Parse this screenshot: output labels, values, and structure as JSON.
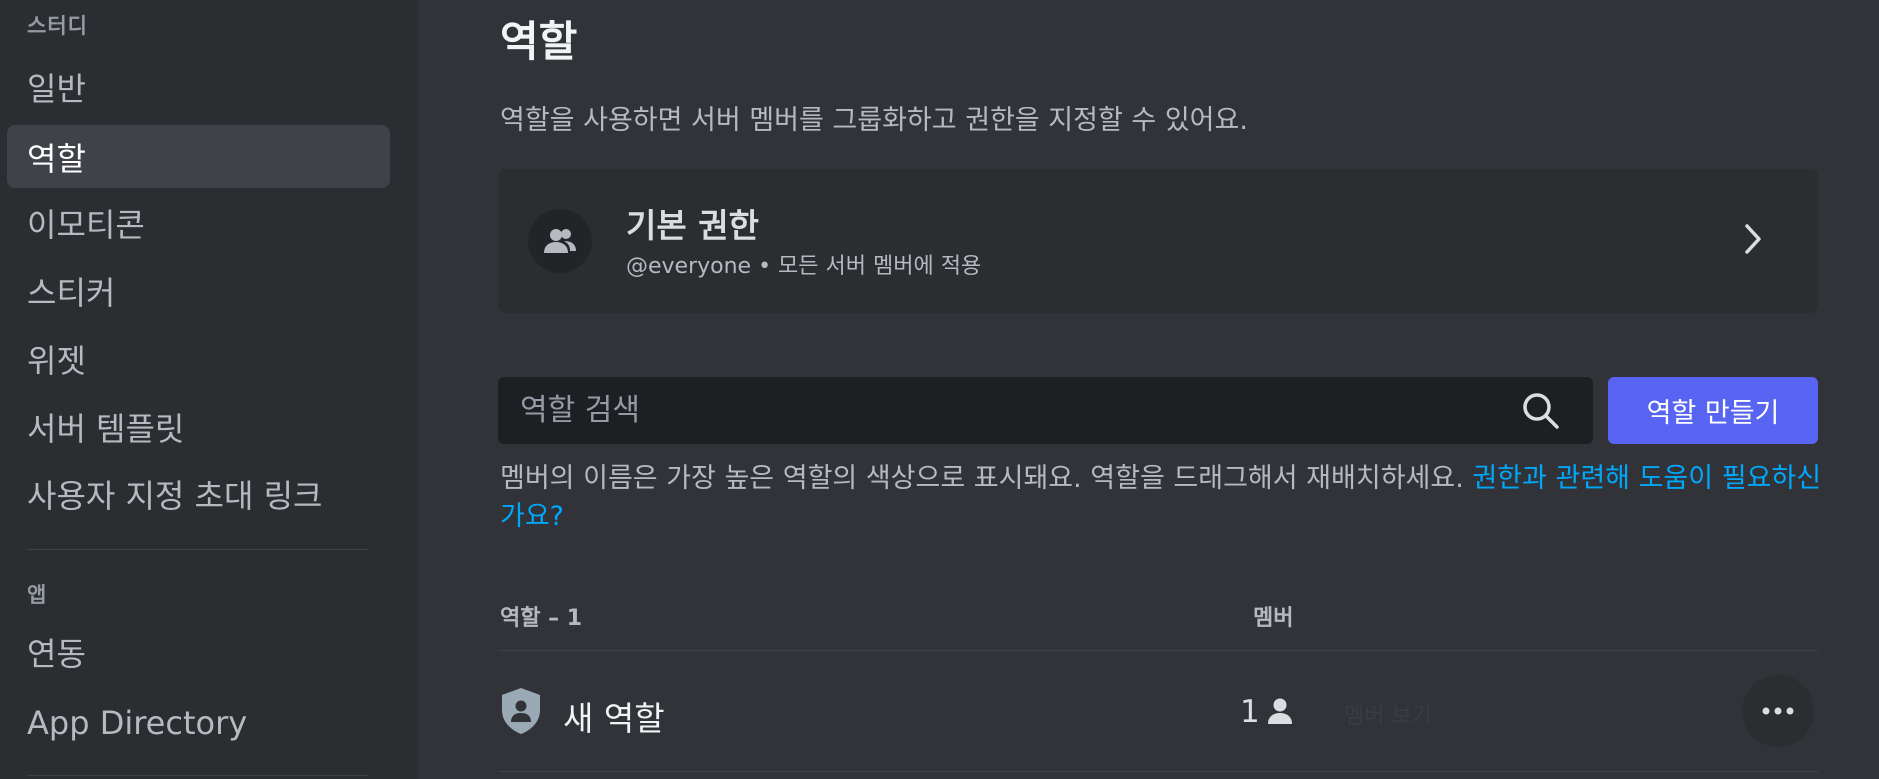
{
  "sidebar": {
    "section_server": "스터디",
    "items": [
      {
        "label": "일반"
      },
      {
        "label": "역할"
      },
      {
        "label": "이모티콘"
      },
      {
        "label": "스티커"
      },
      {
        "label": "위젯"
      },
      {
        "label": "서버 템플릿"
      },
      {
        "label": "사용자 지정 초대 링크"
      }
    ],
    "section_apps": "앱",
    "app_items": [
      {
        "label": "연동"
      },
      {
        "label": "App Directory"
      }
    ],
    "selected": "역할"
  },
  "main": {
    "title": "역할",
    "description": "역할을 사용하면 서버 멤버를 그룹화하고 권한을 지정할 수 있어요.",
    "default_permissions": {
      "title": "기본 권한",
      "subtitle": "@everyone • 모든 서버 멤버에 적용"
    },
    "search": {
      "placeholder": "역할 검색"
    },
    "create_button": "역할 만들기",
    "help_text": "멤버의 이름은 가장 높은 역할의 색상으로 표시돼요. 역할을 드래그해서 재배치하세요. ",
    "help_link": "권한과 관련해 도움이 필요하신가요?",
    "table": {
      "col_roles": "역할 – 1",
      "col_members": "멤버",
      "rows": [
        {
          "name": "새 역할",
          "members": "1",
          "faint_label": "멤버 보기"
        }
      ]
    }
  },
  "colors": {
    "accent": "#5865f2",
    "link": "#00a8fc",
    "background": "#313338",
    "sidebar": "#2b2d31",
    "role_shield": "#99aab5"
  }
}
